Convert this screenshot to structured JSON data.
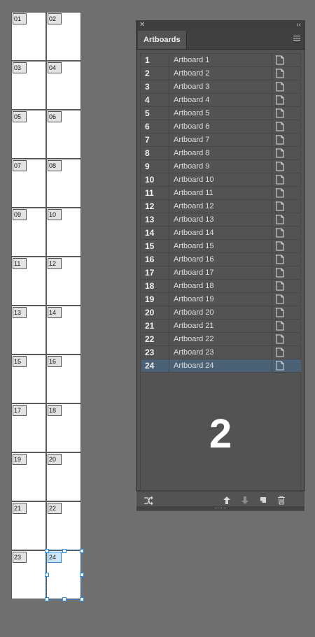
{
  "panel": {
    "close_glyph": "✕",
    "collapse_glyph": "‹‹",
    "tab_label": "Artboards",
    "big_number": "2",
    "rows": [
      {
        "num": "1",
        "name": "Artboard 1"
      },
      {
        "num": "2",
        "name": "Artboard 2"
      },
      {
        "num": "3",
        "name": "Artboard 3"
      },
      {
        "num": "4",
        "name": "Artboard 4"
      },
      {
        "num": "5",
        "name": "Artboard 5"
      },
      {
        "num": "6",
        "name": "Artboard 6"
      },
      {
        "num": "7",
        "name": "Artboard 7"
      },
      {
        "num": "8",
        "name": "Artboard 8"
      },
      {
        "num": "9",
        "name": "Artboard 9"
      },
      {
        "num": "10",
        "name": "Artboard 10"
      },
      {
        "num": "11",
        "name": "Artboard 11"
      },
      {
        "num": "12",
        "name": "Artboard 12"
      },
      {
        "num": "13",
        "name": "Artboard 13"
      },
      {
        "num": "14",
        "name": "Artboard 14"
      },
      {
        "num": "15",
        "name": "Artboard 15"
      },
      {
        "num": "16",
        "name": "Artboard 16"
      },
      {
        "num": "17",
        "name": "Artboard 17"
      },
      {
        "num": "18",
        "name": "Artboard 18"
      },
      {
        "num": "19",
        "name": "Artboard 19"
      },
      {
        "num": "20",
        "name": "Artboard 20"
      },
      {
        "num": "21",
        "name": "Artboard 21"
      },
      {
        "num": "22",
        "name": "Artboard 22"
      },
      {
        "num": "23",
        "name": "Artboard 23"
      },
      {
        "num": "24",
        "name": "Artboard 24",
        "selected": true
      }
    ]
  },
  "canvas": {
    "artboard_tags": [
      "01",
      "02",
      "03",
      "04",
      "05",
      "06",
      "07",
      "08",
      "09",
      "10",
      "11",
      "12",
      "13",
      "14",
      "15",
      "16",
      "17",
      "18",
      "19",
      "20",
      "21",
      "22",
      "23",
      "24"
    ],
    "selected_tag": "24"
  },
  "colors": {
    "selection": "#2a8be6",
    "selected_row": "#4a6176",
    "panel_bg": "#535353",
    "canvas_bg": "#6f6f6f"
  }
}
